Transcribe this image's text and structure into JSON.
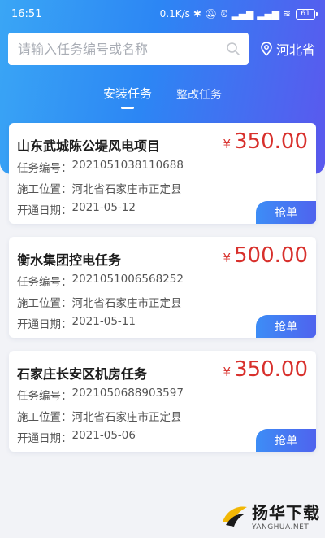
{
  "status_bar": {
    "time": "16:51",
    "network_speed": "0.1K/s",
    "icons": [
      "bluetooth-icon",
      "mute-icon",
      "alarm-icon",
      "signal-icon",
      "signal-icon",
      "wifi-icon"
    ],
    "battery": "61"
  },
  "search": {
    "placeholder": "请输入任务编号或名称",
    "value": ""
  },
  "location": {
    "label": "河北省"
  },
  "tabs": [
    {
      "label": "安装任务",
      "active": true
    },
    {
      "label": "整改任务",
      "active": false
    }
  ],
  "field_labels": {
    "task_no": "任务编号：",
    "site": "施工位置：",
    "date": "开通日期："
  },
  "currency_symbol": "¥",
  "tasks": [
    {
      "title": "山东武城陈公堤风电项目",
      "price": "350.00",
      "task_no": "2021051038110688",
      "site": "河北省石家庄市正定县",
      "date": "2021-05-12",
      "button": "抢单"
    },
    {
      "title": "衡水集团控电任务",
      "price": "500.00",
      "task_no": "2021051006568252",
      "site": "河北省石家庄市正定县",
      "date": "2021-05-11",
      "button": "抢单"
    },
    {
      "title": "石家庄长安区机房任务",
      "price": "350.00",
      "task_no": "2021050688903597",
      "site": "河北省石家庄市正定县",
      "date": "2021-05-06",
      "button": "抢单"
    }
  ],
  "watermark": {
    "name": "扬华下载",
    "url": "YANGHUA.NET"
  },
  "colors": {
    "header_gradient_start": "#3aa6f5",
    "header_gradient_end": "#5b58ee",
    "price": "#d8302c",
    "button": "#4a74f2"
  }
}
